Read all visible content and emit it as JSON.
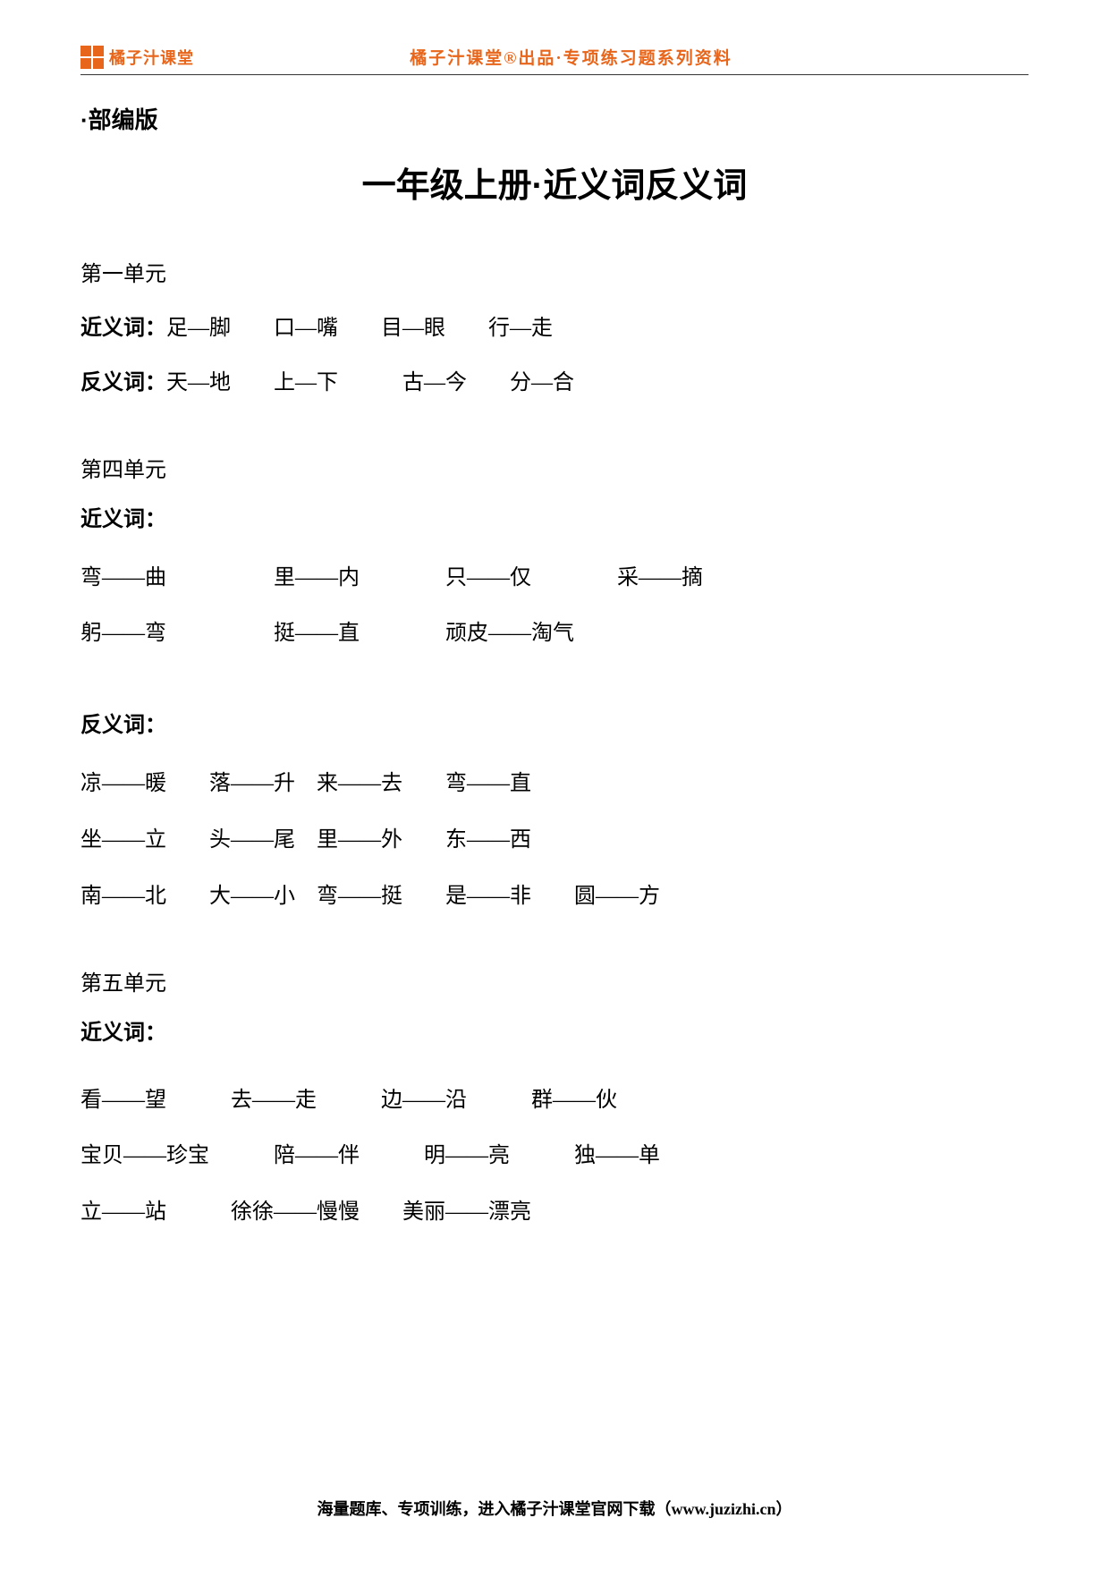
{
  "header": {
    "logo_text": "橘子汁课堂",
    "center_text": "橘子汁课堂®出品·专项练习题系列资料"
  },
  "edition": "·部编版",
  "main_title": "一年级上册·近义词反义词",
  "unit1": {
    "title": "第一单元",
    "synonym_label": "近义词：",
    "synonym_content": "足—脚　　口—嘴　　目—眼　　行—走",
    "antonym_label": "反义词：",
    "antonym_content": "天—地　　上—下　　　古—今　　分—合"
  },
  "unit4": {
    "title": "第四单元",
    "synonym_label": "近义词：",
    "synonym_line1": "弯——曲　　　　　里——内　　　　只——仅　　　　采——摘",
    "synonym_line2": "躬——弯　　　　　挺——直　　　　顽皮——淘气",
    "antonym_label": "反义词：",
    "antonym_line1": "凉——暖　　落——升　来——去　　弯——直",
    "antonym_line2": "坐——立　　头——尾　里——外　　东——西",
    "antonym_line3": "南——北　　大——小　弯——挺　　是——非　　圆——方"
  },
  "unit5": {
    "title": "第五单元",
    "synonym_label": "近义词：",
    "synonym_line1": "看——望　　　去——走　　　边——沿　　　群——伙",
    "synonym_line2": "宝贝——珍宝　　　陪——伴　　　明——亮　　　独——单",
    "synonym_line3": "立——站　　　徐徐——慢慢　　美丽——漂亮"
  },
  "footer": "海量题库、专项训练，进入橘子汁课堂官网下载（www.juzizhi.cn）"
}
